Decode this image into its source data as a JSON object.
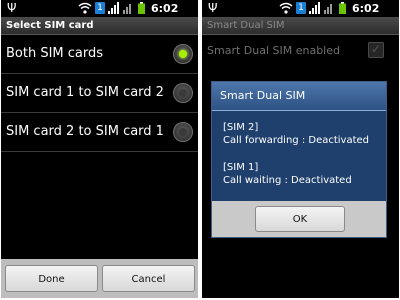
{
  "status_bar": {
    "usb_icon": "usb-icon",
    "sim_badge": "1",
    "time": "6:02 PM"
  },
  "left": {
    "title": "Select SIM card",
    "options": [
      {
        "label": "Both SIM cards",
        "selected": true
      },
      {
        "label": "SIM card 1 to SIM card 2",
        "selected": false
      },
      {
        "label": "SIM card 2 to SIM card 1",
        "selected": false
      }
    ],
    "buttons": {
      "done": "Done",
      "cancel": "Cancel"
    }
  },
  "right": {
    "title": "Smart Dual SIM",
    "setting_label": "Smart Dual SIM enabled",
    "setting_checked": true,
    "dialog": {
      "title": "Smart Dual SIM",
      "sim2_header": "[SIM 2]",
      "sim2_status": "Call forwarding : Deactivated",
      "sim1_header": "[SIM 1]",
      "sim1_status": "Call waiting : Deactivated",
      "ok_label": "OK"
    }
  },
  "colors": {
    "radio_selected": "#a8f000",
    "dialog_title": "#3e6599",
    "dialog_body": "#1f3f6c",
    "sim_badge": "#1b7fd6"
  }
}
